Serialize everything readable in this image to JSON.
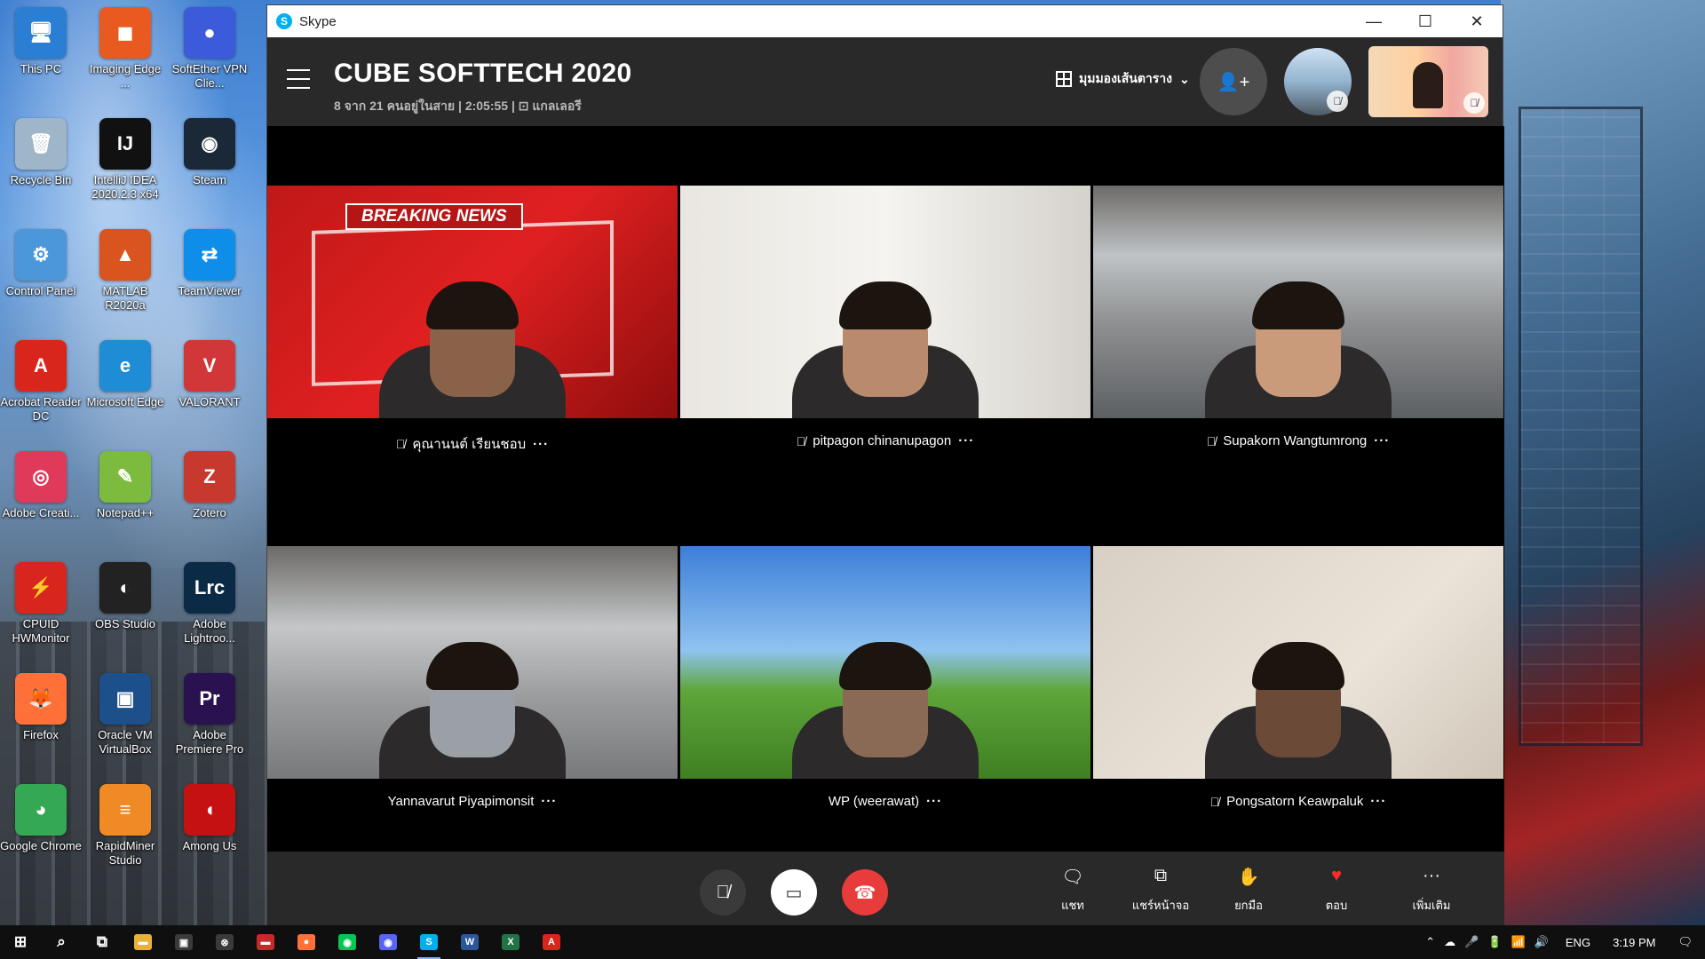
{
  "desktop": {
    "icons": [
      {
        "label": "This PC",
        "color": "#2a7fd4",
        "glyph": "🖥"
      },
      {
        "label": "Imaging Edge ...",
        "color": "#e85a1f",
        "glyph": "◼"
      },
      {
        "label": "SoftEther VPN Clie...",
        "color": "#3b5bdb",
        "glyph": "●"
      },
      {
        "label": "Recycle Bin",
        "color": "#9fb6c8",
        "glyph": "🗑"
      },
      {
        "label": "IntelliJ IDEA 2020.2.3 x64",
        "color": "#111111",
        "glyph": "IJ"
      },
      {
        "label": "Steam",
        "color": "#1b2838",
        "glyph": "◉"
      },
      {
        "label": "Control Panel",
        "color": "#4c97d9",
        "glyph": "⚙"
      },
      {
        "label": "MATLAB R2020a",
        "color": "#d9541e",
        "glyph": "▲"
      },
      {
        "label": "TeamViewer",
        "color": "#0e8ee9",
        "glyph": "⇄"
      },
      {
        "label": "Acrobat Reader DC",
        "color": "#d9261c",
        "glyph": "A"
      },
      {
        "label": "Microsoft Edge",
        "color": "#1f8dd6",
        "glyph": "e"
      },
      {
        "label": "VALORANT",
        "color": "#d13639",
        "glyph": "V"
      },
      {
        "label": "Adobe Creati...",
        "color": "#e03a5b",
        "glyph": "◎"
      },
      {
        "label": "Notepad++",
        "color": "#7dbb3e",
        "glyph": "✎"
      },
      {
        "label": "Zotero",
        "color": "#c7392f",
        "glyph": "Z"
      },
      {
        "label": "CPUID HWMonitor",
        "color": "#d8261f",
        "glyph": "⚡"
      },
      {
        "label": "OBS Studio",
        "color": "#222222",
        "glyph": "◐"
      },
      {
        "label": "Adobe Lightroo...",
        "color": "#0b2a46",
        "glyph": "Lrc"
      },
      {
        "label": "Firefox",
        "color": "#ff7139",
        "glyph": "🦊"
      },
      {
        "label": "Oracle VM VirtualBox",
        "color": "#1d4f8a",
        "glyph": "▣"
      },
      {
        "label": "Adobe Premiere Pro",
        "color": "#2a1251",
        "glyph": "Pr"
      },
      {
        "label": "Google Chrome",
        "color": "#34a853",
        "glyph": "◕"
      },
      {
        "label": "RapidMiner Studio",
        "color": "#f08a24",
        "glyph": "≡"
      },
      {
        "label": "Among Us",
        "color": "#c51111",
        "glyph": "◖"
      }
    ]
  },
  "window": {
    "app_name": "Skype",
    "minimize": "—",
    "maximize": "☐",
    "close": "✕"
  },
  "call": {
    "title": "CUBE SOFTTECH 2020",
    "subtitle": "8 จาก 21 คนอยู่ในสาย | 2:05:55 | ⊡ แกลเลอรี",
    "view_label": "มุมมองเส้นตาราง",
    "view_caret": "⌄",
    "add_people_icon": "👤+"
  },
  "participants": [
    {
      "name": "คุณานนต์ เรียนชอบ",
      "muted": true,
      "bg": "red-news",
      "banner": "BREAKING NEWS"
    },
    {
      "name": "pitpagon chinanupagon",
      "muted": true,
      "bg": "room"
    },
    {
      "name": "Supakorn Wangtumrong",
      "muted": true,
      "bg": "loft"
    },
    {
      "name": "Yannavarut Piyapimonsit",
      "muted": false,
      "bg": "loft2"
    },
    {
      "name": "WP (weerawat)",
      "muted": false,
      "bg": "bliss"
    },
    {
      "name": "Pongsatorn Keawpaluk",
      "muted": true,
      "bg": "wall"
    }
  ],
  "more_glyph": "···",
  "mic_off_glyph": "🎙̸",
  "callbar": {
    "mute_glyph": "🎙̸",
    "video_glyph": "▭",
    "hangup_glyph": "☎",
    "actions": [
      {
        "label": "แชท",
        "glyph": "🗨"
      },
      {
        "label": "แชร์หน้าจอ",
        "glyph": "⧉"
      },
      {
        "label": "ยกมือ",
        "glyph": "✋"
      },
      {
        "label": "ตอบ",
        "glyph": "♥"
      },
      {
        "label": "เพิ่มเติม",
        "glyph": "···"
      }
    ]
  },
  "taskbar": {
    "language": "ENG",
    "time": "3:19 PM",
    "apps": [
      {
        "name": "start",
        "glyph": "⊞",
        "color": "transparent"
      },
      {
        "name": "search",
        "glyph": "⌕",
        "color": "transparent"
      },
      {
        "name": "task-view",
        "glyph": "⧉",
        "color": "transparent"
      },
      {
        "name": "file-explorer",
        "glyph": "▬",
        "color": "#e8b23a"
      },
      {
        "name": "store",
        "glyph": "▣",
        "color": "#3a3a3a"
      },
      {
        "name": "xbox",
        "glyph": "⊗",
        "color": "#3a3a3a"
      },
      {
        "name": "app-red",
        "glyph": "▬",
        "color": "#c8282a"
      },
      {
        "name": "firefox",
        "glyph": "●",
        "color": "#ff7139"
      },
      {
        "name": "line",
        "glyph": "◉",
        "color": "#06c755"
      },
      {
        "name": "discord",
        "glyph": "◉",
        "color": "#5865f2"
      },
      {
        "name": "skype",
        "glyph": "S",
        "color": "#00aff0"
      },
      {
        "name": "word",
        "glyph": "W",
        "color": "#2b579a"
      },
      {
        "name": "excel",
        "glyph": "X",
        "color": "#217346"
      },
      {
        "name": "acrobat",
        "glyph": "A",
        "color": "#d9261c"
      }
    ],
    "tray_icons": [
      "⌃",
      "☁",
      "🎤",
      "🔋",
      "📶",
      "🔊"
    ],
    "notification_glyph": "🗨"
  }
}
